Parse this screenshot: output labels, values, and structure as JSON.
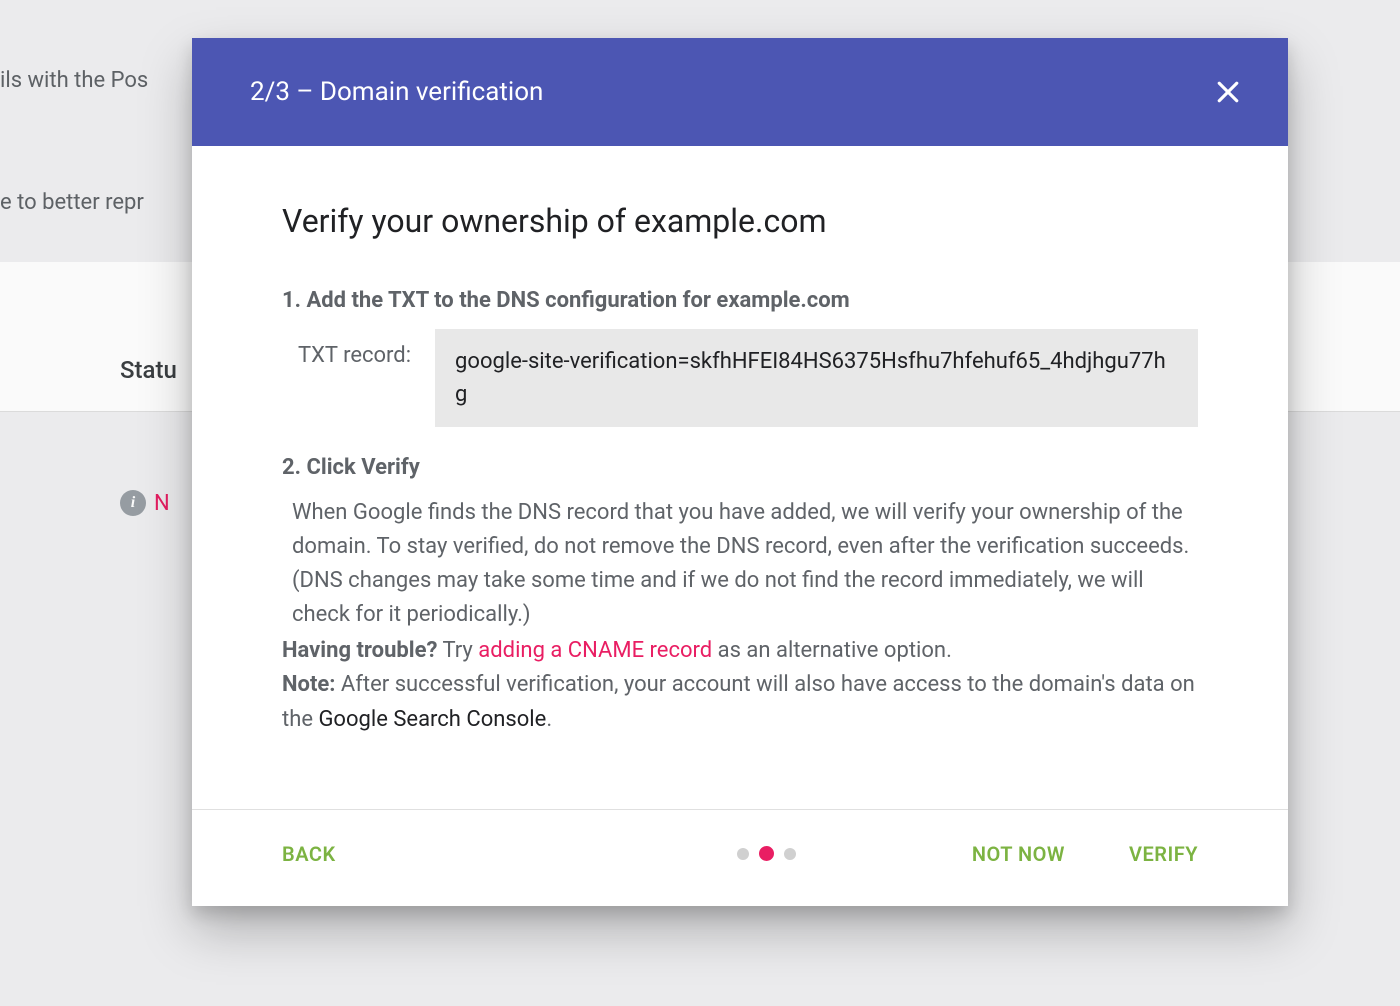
{
  "background": {
    "text1": "ils with the Pos",
    "text2": "e to better repr",
    "status_label": "Statu",
    "info_text": "N"
  },
  "modal": {
    "header_title": "2/3 – Domain verification",
    "heading": "Verify your ownership of example.com",
    "step1_title": "1. Add the TXT to the DNS configuration for example.com",
    "txt_label": "TXT record:",
    "txt_value": "google-site-verification=skfhHFEI84HS6375Hsfhu7hfehuf65_4hdjhgu77hg",
    "step2_title": "2. Click Verify",
    "step2_desc": "When Google finds the DNS record that you have added, we will verify your ownership of the domain. To stay verified, do not remove the DNS record, even after the verification succeeds. (DNS changes may take some time and if we do not find the record immediately, we will check for it periodically.)",
    "trouble_label": "Having trouble?",
    "trouble_try": " Try ",
    "cname_link": "adding a CNAME record",
    "trouble_suffix": " as an alternative option.",
    "note_label": "Note:",
    "note_text": " After successful verification, your account will also have access to the domain's data on the ",
    "gsc_text": "Google Search Console",
    "note_period": ".",
    "back_label": "BACK",
    "notnow_label": "NOT NOW",
    "verify_label": "VERIFY"
  }
}
